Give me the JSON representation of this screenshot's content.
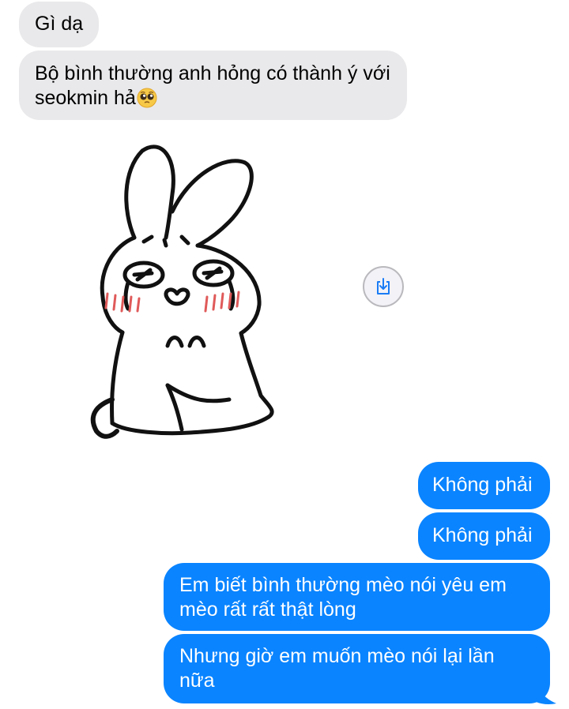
{
  "conversation": {
    "incoming": [
      {
        "text": "Gì dạ"
      },
      {
        "text": "Bộ bình thường anh hỏng có thành ý với seokmin hả"
      }
    ],
    "incoming_emoji": "pleading-face-emoji",
    "sticker": {
      "subject": "crying bunny sticker",
      "save_icon": "square-arrow-down-icon"
    },
    "outgoing": [
      {
        "text": "Không phải"
      },
      {
        "text": "Không phải"
      },
      {
        "text": "Em biết bình thường mèo nói yêu em mèo rất rất thật lòng"
      },
      {
        "text": "Nhưng giờ em muốn mèo nói lại lần nữa"
      }
    ]
  },
  "colors": {
    "incoming_bubble": "#e9e9eb",
    "outgoing_bubble": "#0a84ff",
    "outgoing_text": "#ffffff"
  }
}
